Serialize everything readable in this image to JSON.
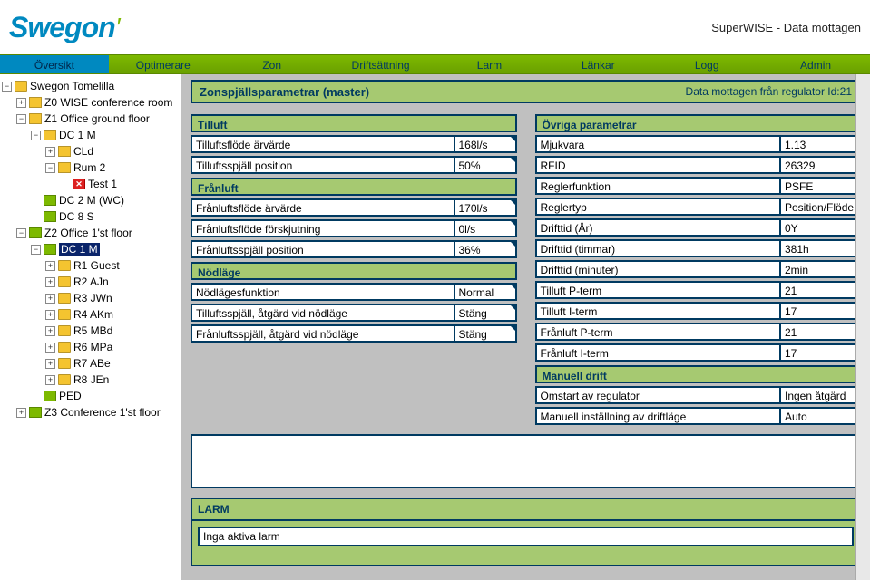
{
  "header": {
    "logo_text": "Swegon",
    "status": "SuperWISE - Data mottagen"
  },
  "nav": {
    "items": [
      "Översikt",
      "Optimerare",
      "Zon",
      "Driftsättning",
      "Larm",
      "Länkar",
      "Logg",
      "Admin"
    ],
    "active": 0
  },
  "tree": [
    {
      "indent": 0,
      "toggle": "-",
      "icon": "folder",
      "label": "Swegon Tomelilla"
    },
    {
      "indent": 1,
      "toggle": "+",
      "icon": "yellow",
      "label": "Z0 WISE conference room"
    },
    {
      "indent": 1,
      "toggle": "-",
      "icon": "yellow",
      "label": "Z1 Office ground floor"
    },
    {
      "indent": 2,
      "toggle": "-",
      "icon": "yellow",
      "label": "DC 1 M"
    },
    {
      "indent": 3,
      "toggle": "+",
      "icon": "yellow",
      "label": "CLd"
    },
    {
      "indent": 3,
      "toggle": "-",
      "icon": "yellow",
      "label": "Rum 2"
    },
    {
      "indent": 4,
      "toggle": "",
      "icon": "red",
      "label": "Test 1"
    },
    {
      "indent": 2,
      "toggle": "",
      "icon": "green",
      "label": "DC 2 M (WC)"
    },
    {
      "indent": 2,
      "toggle": "",
      "icon": "green",
      "label": "DC 8 S"
    },
    {
      "indent": 1,
      "toggle": "-",
      "icon": "green",
      "label": "Z2 Office 1'st floor"
    },
    {
      "indent": 2,
      "toggle": "-",
      "icon": "green",
      "label": "DC 1 M",
      "selected": true
    },
    {
      "indent": 3,
      "toggle": "+",
      "icon": "folder",
      "label": "R1 Guest"
    },
    {
      "indent": 3,
      "toggle": "+",
      "icon": "folder",
      "label": "R2 AJn"
    },
    {
      "indent": 3,
      "toggle": "+",
      "icon": "folder",
      "label": "R3 JWn"
    },
    {
      "indent": 3,
      "toggle": "+",
      "icon": "folder",
      "label": "R4 AKm"
    },
    {
      "indent": 3,
      "toggle": "+",
      "icon": "folder",
      "label": "R5 MBd"
    },
    {
      "indent": 3,
      "toggle": "+",
      "icon": "folder",
      "label": "R6 MPa"
    },
    {
      "indent": 3,
      "toggle": "+",
      "icon": "folder",
      "label": "R7 ABe"
    },
    {
      "indent": 3,
      "toggle": "+",
      "icon": "folder",
      "label": "R8 JEn"
    },
    {
      "indent": 2,
      "toggle": "",
      "icon": "green",
      "label": "PED"
    },
    {
      "indent": 1,
      "toggle": "+",
      "icon": "green",
      "label": "Z3 Conference 1'st floor"
    }
  ],
  "panel": {
    "title": "Zonspjällsparametrar (master)",
    "subtitle": "Data mottagen från regulator Id:21"
  },
  "sections_left": [
    {
      "header": "Tilluft",
      "rows": [
        {
          "label": "Tilluftsflöde ärvärde",
          "value": "168l/s"
        },
        {
          "label": "Tilluftsspjäll position",
          "value": "50%"
        }
      ]
    },
    {
      "header": "Frånluft",
      "rows": [
        {
          "label": "Frånluftsflöde ärvärde",
          "value": "170l/s"
        },
        {
          "label": "Frånluftsflöde förskjutning",
          "value": "0l/s"
        },
        {
          "label": "Frånluftsspjäll position",
          "value": "36%"
        }
      ]
    },
    {
      "header": "Nödläge",
      "rows": [
        {
          "label": "Nödlägesfunktion",
          "value": "Normal"
        },
        {
          "label": "Tilluftsspjäll, åtgärd vid nödläge",
          "value": "Stäng"
        },
        {
          "label": "Frånluftsspjäll, åtgärd vid nödläge",
          "value": "Stäng"
        }
      ]
    }
  ],
  "sections_right": [
    {
      "header": "Övriga parametrar",
      "rows": [
        {
          "label": "Mjukvara",
          "value": "1.13"
        },
        {
          "label": "RFID",
          "value": "26329"
        },
        {
          "label": "Reglerfunktion",
          "value": "PSFE"
        },
        {
          "label": "Reglertyp",
          "value": "Position/Flöde"
        },
        {
          "label": "Drifttid (År)",
          "value": "0Y"
        },
        {
          "label": "Drifttid (timmar)",
          "value": "381h"
        },
        {
          "label": "Drifttid (minuter)",
          "value": "2min"
        },
        {
          "label": "Tilluft P-term",
          "value": "21"
        },
        {
          "label": "Tilluft I-term",
          "value": "17"
        },
        {
          "label": "Frånluft P-term",
          "value": "21"
        },
        {
          "label": "Frånluft I-term",
          "value": "17"
        }
      ]
    },
    {
      "header": "Manuell drift",
      "rows": [
        {
          "label": "Omstart av regulator",
          "value": "Ingen åtgärd"
        },
        {
          "label": "Manuell inställning av driftläge",
          "value": "Auto"
        }
      ]
    }
  ],
  "alarm": {
    "header": "LARM",
    "text": "Inga aktiva larm"
  }
}
